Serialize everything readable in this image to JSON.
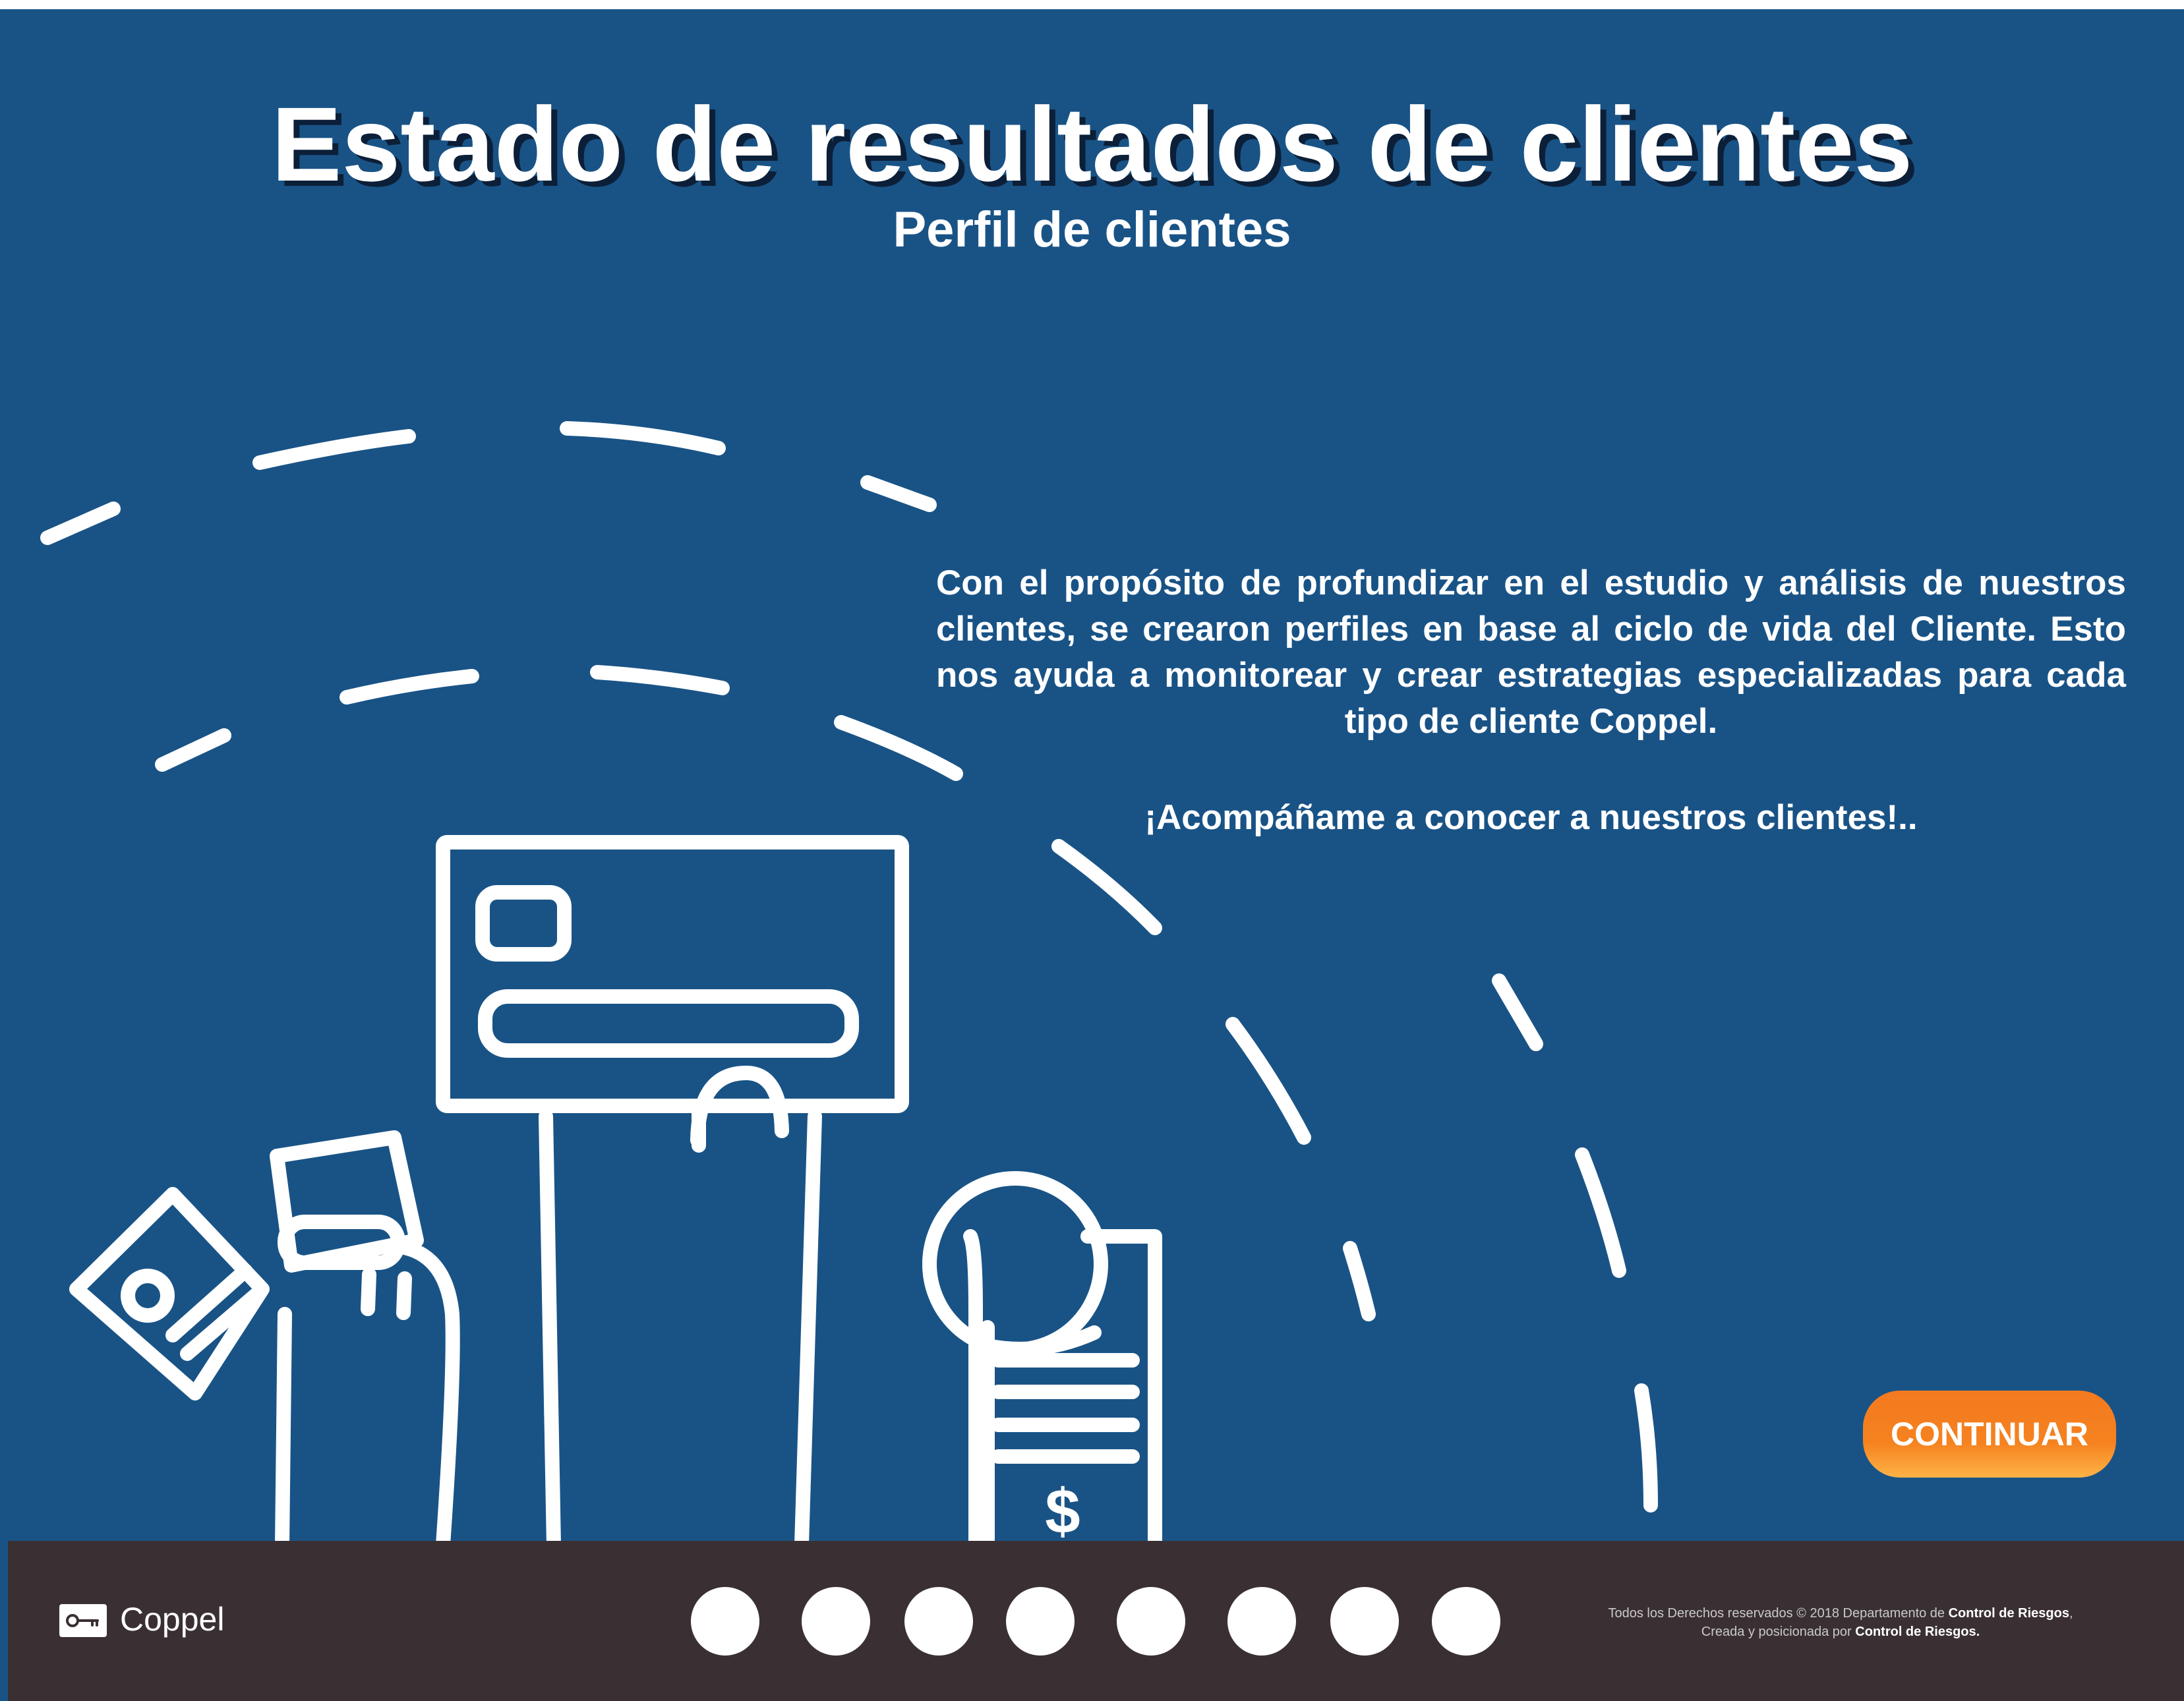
{
  "header": {
    "title": "Estado de resultados de clientes",
    "subtitle": "Perfil de clientes"
  },
  "intro": {
    "paragraph": "Con el propósito de profundizar en el estudio y análisis de nuestros clientes, se crearon perfiles en base al ciclo de vida del Cliente. Esto nos ayuda a monitorear y crear estrategias especializadas para cada tipo de cliente Coppel.",
    "call_to_action": "¡Acompáñame a conocer a nuestros clientes!.."
  },
  "illustration": {
    "receipt_symbol": "$",
    "icons": [
      "hand-with-sign-icon",
      "hand-with-cards-icon",
      "hand-with-receipt-icon",
      "dashed-arcs"
    ]
  },
  "continue_button": {
    "label": "CONTINUAR"
  },
  "footer": {
    "brand": "Coppel",
    "logo_icon": "key-icon",
    "pagination_count": 8,
    "copyright_line1_prefix": "Todos los Derechos reservados © 2018 Departamento de ",
    "copyright_line1_bold": "Control de Riesgos",
    "copyright_line1_suffix": ",",
    "copyright_line2_prefix": "Creada y posicionada por ",
    "copyright_line2_bold": "Control  de Riesgos."
  },
  "colors": {
    "background": "#195386",
    "footer": "#3a3034",
    "accent": "#f5821f",
    "foreground": "#ffffff"
  }
}
